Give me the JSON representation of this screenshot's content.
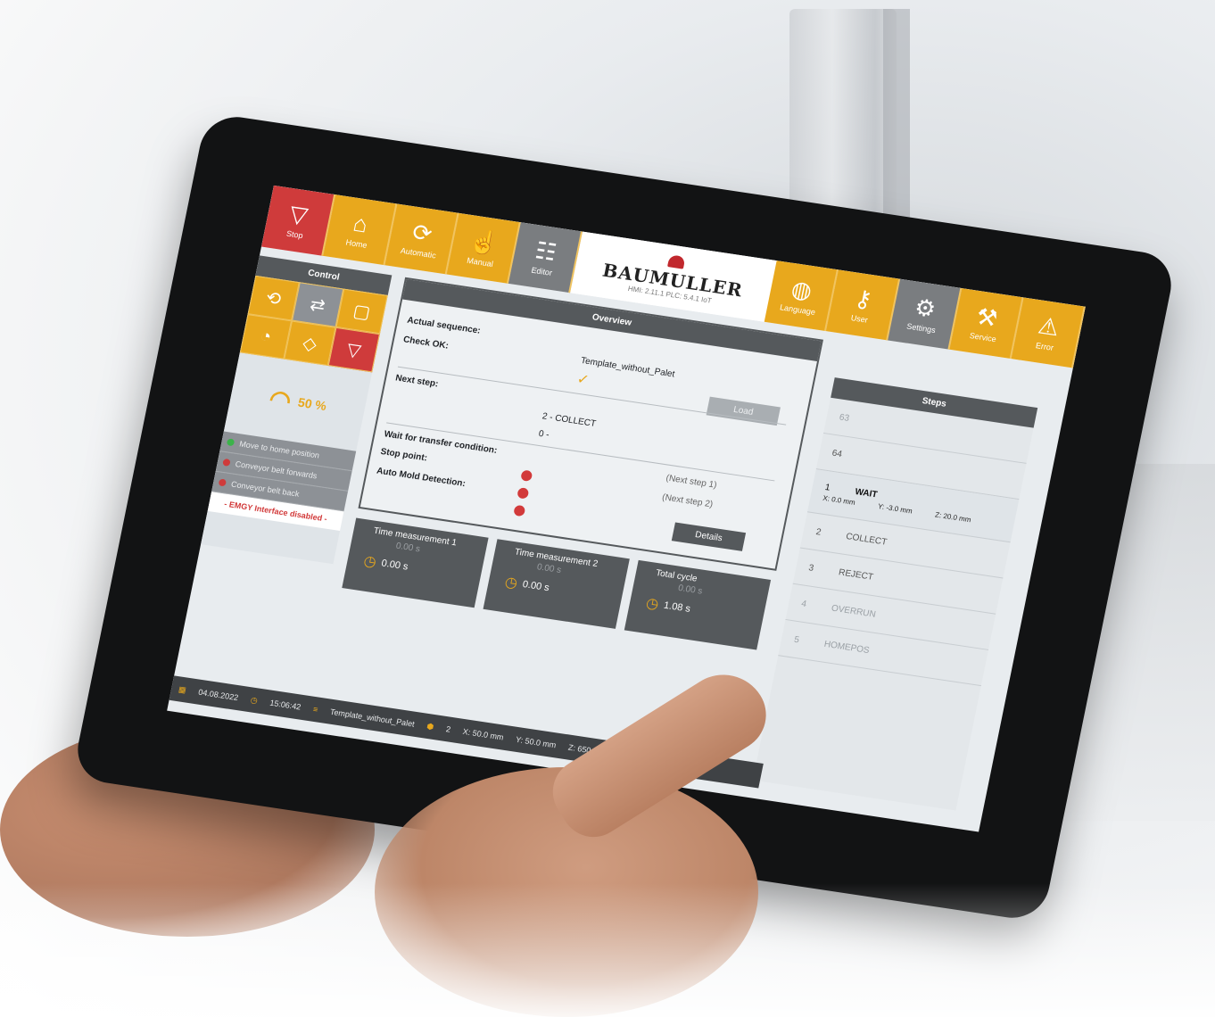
{
  "brand": {
    "name": "BAUMULLER",
    "version": "HMI: 2.11.1   PLC: 5.4.1 IoT"
  },
  "topbar": {
    "left_buttons": [
      {
        "label": "Stop",
        "icon": "stop-icon"
      },
      {
        "label": "Home",
        "icon": "home-icon"
      },
      {
        "label": "Automatic",
        "icon": "automatic-icon"
      },
      {
        "label": "Manual",
        "icon": "hand-icon"
      },
      {
        "label": "Editor",
        "icon": "editor-icon"
      }
    ],
    "right_buttons": [
      {
        "label": "Language",
        "icon": "globe-icon"
      },
      {
        "label": "User",
        "icon": "key-icon"
      },
      {
        "label": "Settings",
        "icon": "gears-icon"
      },
      {
        "label": "Service",
        "icon": "tools-icon"
      },
      {
        "label": "Error",
        "icon": "warning-icon"
      }
    ]
  },
  "control": {
    "title": "Control",
    "speed": "50 %",
    "actions": [
      {
        "label": "Move to home position",
        "state": "ok"
      },
      {
        "label": "Conveyor belt forwards",
        "state": "error"
      },
      {
        "label": "Conveyor belt back",
        "state": "error"
      }
    ],
    "emergency": "- EMGY Interface disabled -"
  },
  "overview": {
    "title": "Overview",
    "actual_sequence_label": "Actual sequence:",
    "actual_sequence_value": "Template_without_Palet",
    "check_ok_label": "Check OK:",
    "load_label": "Load",
    "next_step_label": "Next step:",
    "next_step_value": "2 - COLLECT",
    "next_step_sub": "0 -",
    "wait_label": "Wait for transfer condition:",
    "wait_value": "(Next step 1)",
    "stop_point_label": "Stop point:",
    "stop_point_value": "(Next step 2)",
    "auto_mold_label": "Auto Mold Detection:",
    "details_label": "Details"
  },
  "timers": [
    {
      "title": "Time measurement 1",
      "ghost": "0.00 s",
      "value": "0.00 s"
    },
    {
      "title": "Time measurement 2",
      "ghost": "0.00 s",
      "value": "0.00 s"
    },
    {
      "title": "Total cycle",
      "ghost": "0.00 s",
      "value": "1.08 s"
    }
  ],
  "steps": {
    "title": "Steps",
    "rows": [
      {
        "n": "63",
        "name": ""
      },
      {
        "n": "64",
        "name": ""
      },
      {
        "n": "1",
        "name": "WAIT",
        "x": "X: 0.0 mm",
        "y": "Y: -3.0 mm",
        "z": "Z: 20.0 mm"
      },
      {
        "n": "2",
        "name": "COLLECT"
      },
      {
        "n": "3",
        "name": "REJECT"
      },
      {
        "n": "4",
        "name": "OVERRUN"
      },
      {
        "n": "5",
        "name": "HOMEPOS"
      }
    ]
  },
  "statusbar": {
    "date": "04.08.2022",
    "time": "15:06:42",
    "program": "Template_without_Palet",
    "count": "2",
    "x": "X: 50.0 mm",
    "y": "Y: 50.0 mm",
    "z": "Z: 650.0 mm"
  },
  "colors": {
    "accent": "#e8a81d",
    "stop": "#cf3b3b",
    "panel_dark": "#55595c"
  }
}
